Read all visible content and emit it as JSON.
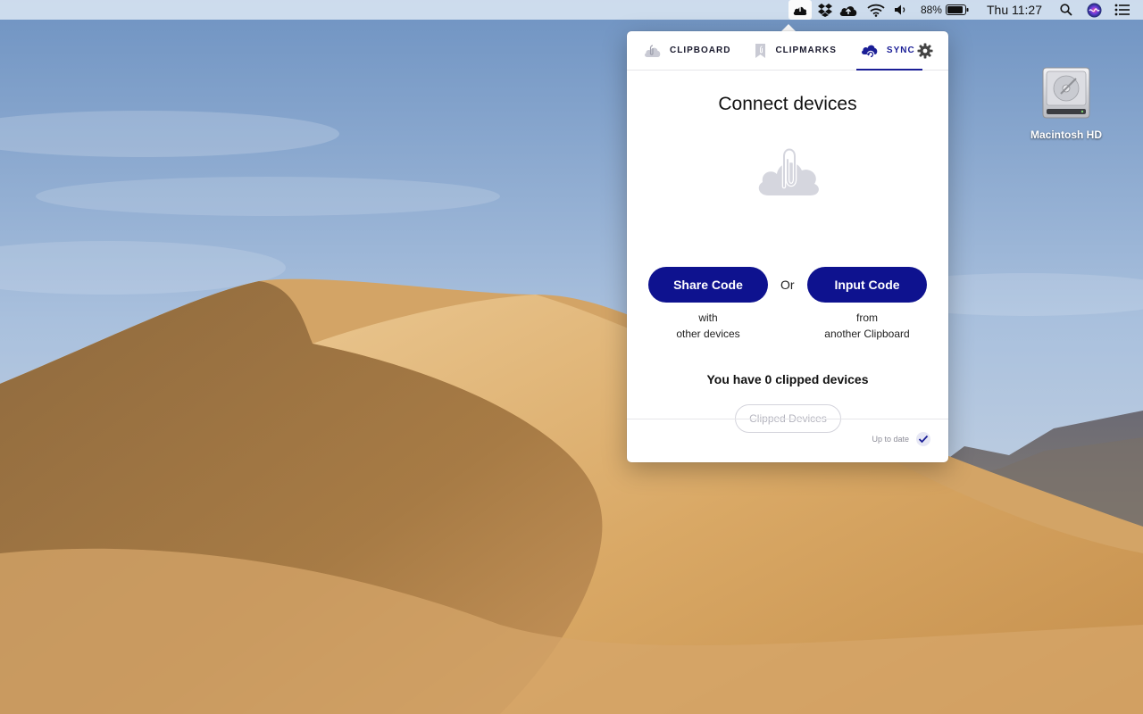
{
  "menubar": {
    "battery_percent": "88%",
    "clock": "Thu 11:27",
    "icons": [
      "clipboard-cloud-icon",
      "dropbox-icon",
      "cloud-upload-icon",
      "wifi-icon",
      "volume-icon",
      "battery-icon",
      "spotlight-search-icon",
      "siri-icon",
      "notification-center-icon"
    ]
  },
  "desktop": {
    "drive_label": "Macintosh HD"
  },
  "popover": {
    "tabs": [
      {
        "label": "CLIPBOARD",
        "icon": "clipboard-icon",
        "active": false
      },
      {
        "label": "CLIPMARKS",
        "icon": "bookmark-icon",
        "active": false
      },
      {
        "label": "SYNC",
        "icon": "cloud-sync-icon",
        "active": true
      }
    ],
    "settings_icon": "gear-icon",
    "title": "Connect devices",
    "illustration_icon": "paperclip-cloud-icon",
    "share_button": "Share Code",
    "or_label": "Or",
    "input_button": "Input Code",
    "share_caption": {
      "line1": "with",
      "line2": "other devices"
    },
    "input_caption": {
      "line1": "from",
      "line2": "another Clipboard"
    },
    "clipped_count_text": "You have 0 clipped devices",
    "clipped_devices_button": "Clipped Devices",
    "status_text": "Up to date",
    "status_icon": "checkmark-icon"
  },
  "colors": {
    "accent": "#0e128f",
    "menubar": "#e2ecf6",
    "sky": "#8fb0d2",
    "sand": "#c9995a"
  }
}
